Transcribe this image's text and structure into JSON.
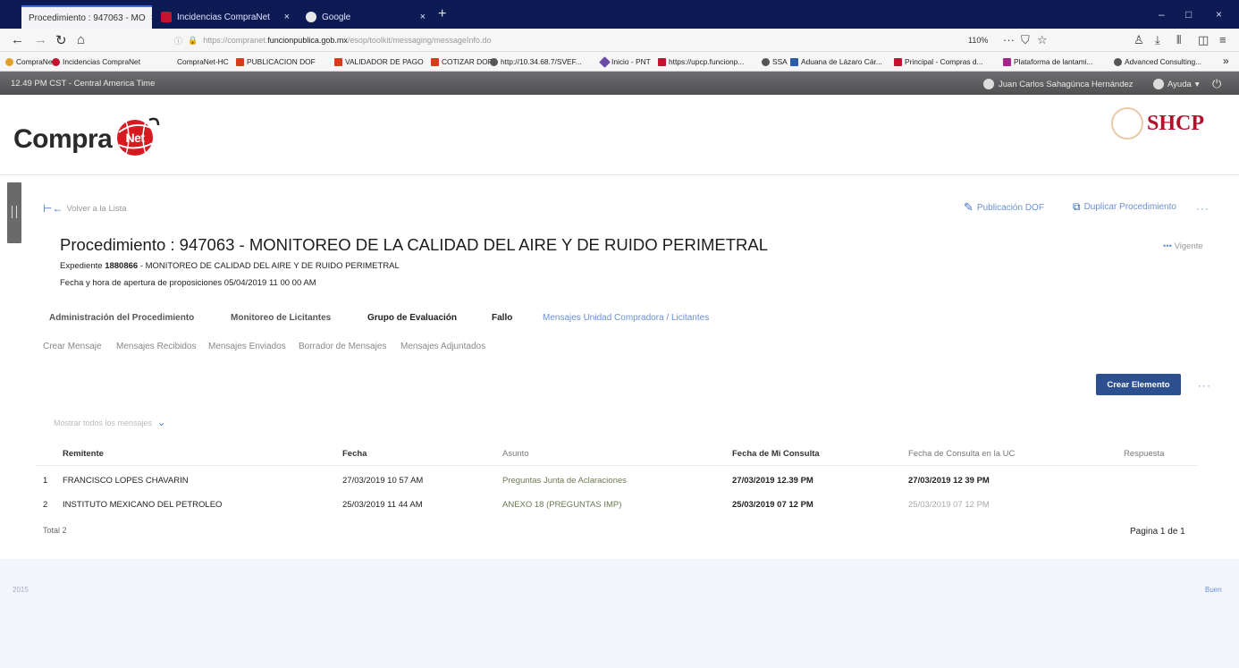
{
  "browser": {
    "tabs": [
      {
        "label": "Procedimiento : 947063 - MO",
        "active": true
      },
      {
        "label": "Incidencias CompraNet",
        "active": false
      },
      {
        "label": "Google",
        "active": false
      }
    ],
    "url_prefix": "https://compranet.",
    "url_host": "funcionpublica.gob.mx",
    "url_path": "/esop/toolkit/messaging/messageInfo.do",
    "zoom": "110%",
    "bookmarks": [
      "CompraNet",
      "Incidencias CompraNet",
      "CompraNet-HC",
      "PUBLICACION DOF",
      "VALIDADOR DE PAGO",
      "COTIZAR DOF",
      "http://10.34.68.7/SVEF...",
      "Inicio - PNT",
      "https://upcp.funcionp...",
      "SSA",
      "Aduana de Lázaro Cár...",
      "Principal - Compras d...",
      "Plataforma de lantami...",
      "Advanced Consulting..."
    ]
  },
  "appbar": {
    "time": "12.49 PM CST - Central America Time",
    "user": "Juan Carlos Sahagúnca Hernández",
    "help": "Ayuda"
  },
  "logos": {
    "compranet_text": "Compra",
    "compranet_globe": "Net",
    "shcp": "SHCP"
  },
  "header": {
    "back_label": "Volver a la Lista",
    "publicacion_dof": "Publicación DOF",
    "duplicar": "Duplicar Procedimiento",
    "title": "Procedimiento : 947063 - MONITOREO DE LA CALIDAD DEL AIRE Y DE RUIDO PERIMETRAL",
    "status": "Vigente",
    "expediente_label": "Expediente",
    "expediente_num": "1880866",
    "expediente_desc": "- MONITOREO DE CALIDAD DEL AIRE Y DE RUIDO PERIMETRAL",
    "fecha_label": "Fecha y hora de apertura de proposiciones",
    "fecha_value": "05/04/2019 11 00 00 AM"
  },
  "main_tabs": [
    "Administración del Procedimiento",
    "Monitoreo de Licitantes",
    "Grupo de Evaluación",
    "Fallo",
    "Mensajes Unidad Compradora / Licitantes"
  ],
  "sub_tabs": [
    "Crear Mensaje",
    "Mensajes Recibidos",
    "Mensajes Enviados",
    "Borrador de Mensajes",
    "Mensajes Adjuntados"
  ],
  "create_button": "Crear Elemento",
  "filter_label": "Mostrar todos los mensajes",
  "table": {
    "headers": [
      "Remitente",
      "Fecha",
      "Asunto",
      "Fecha de Mi Consulta",
      "Fecha de Consulta en la UC",
      "Respuesta"
    ],
    "rows": [
      {
        "n": "1",
        "remitente": "FRANCISCO LOPES CHAVARIN",
        "fecha": "27/03/2019 10 57 AM",
        "asunto": "Preguntas Junta de Aclaraciones",
        "mi_consulta": "27/03/2019 12.39 PM",
        "consulta_uc": "27/03/2019 12 39 PM",
        "respuesta": ""
      },
      {
        "n": "2",
        "remitente": "INSTITUTO MEXICANO DEL PETROLEO",
        "fecha": "25/03/2019 11 44 AM",
        "asunto": "ANEXO 18 (PREGUNTAS IMP)",
        "mi_consulta": "25/03/2019 07 12 PM",
        "consulta_uc": "25/03/2019 07 12 PM",
        "respuesta": ""
      }
    ]
  },
  "total": "Total 2",
  "paging": "Pagina 1 de 1",
  "footer": {
    "left": "2015",
    "right": "Buen"
  },
  "colors": {
    "tabbar": "#0d1b55",
    "appbar": "#5e5e60",
    "button": "#2c4f8f",
    "link": "#6b8fd1",
    "shcp": "#b5102a"
  }
}
